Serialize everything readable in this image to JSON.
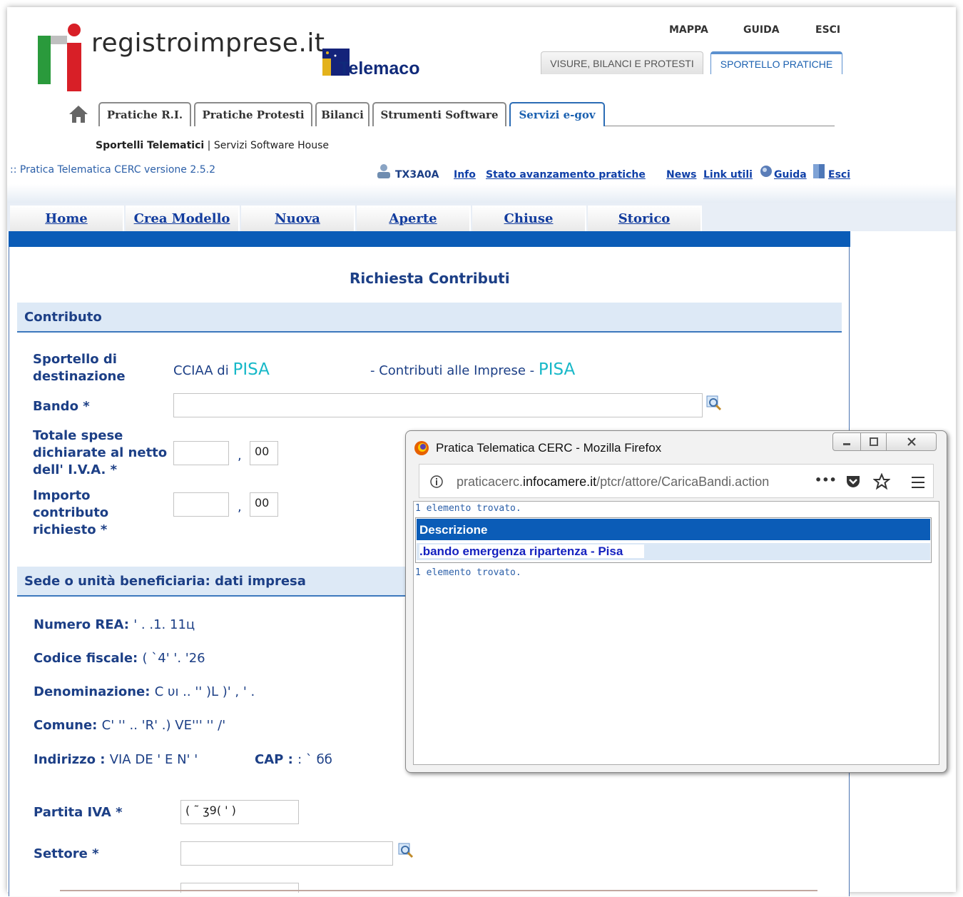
{
  "header": {
    "logo_text": "registroimprese.it",
    "telemaco_text": "Telemaco",
    "top_links": [
      "MAPPA",
      "GUIDA",
      "ESCI"
    ],
    "top_tabs": [
      "VISURE, BILANCI E PROTESTI",
      "SPORTELLO PRATICHE"
    ],
    "nav_tabs": [
      "Pratiche R.I.",
      "Pratiche Protesti",
      "Bilanci",
      "Strumenti Software",
      "Servizi e-gov"
    ],
    "sub_nav_bold": "Sportelli Telematici",
    "sub_nav_sep": "|",
    "sub_nav_other": "Servizi Software House",
    "version_line": ":: Pratica Telematica CERC versione 2.5.2",
    "user_code": "TX3A0A",
    "user_links": [
      "Info",
      "Stato avanzamento pratiche",
      "News",
      "Link utili",
      "Guida",
      "Esci"
    ]
  },
  "menu": {
    "tabs": [
      "Home",
      "Crea Modello",
      "Nuova",
      "Aperte",
      "Chiuse",
      "Storico"
    ]
  },
  "form": {
    "title": "Richiesta Contributi",
    "section_contributo": "Contributo",
    "sportello_label": "Sportello di destinazione",
    "cciaa_prefix": "CCIAA di",
    "cciaa_city": "PISA",
    "contributi_text": "- Contributi alle Imprese -",
    "contributi_city": "PISA",
    "bando_label": "Bando *",
    "bando_value": "",
    "totale_label": "Totale spese dichiarate al netto dell' I.V.A. *",
    "totale_int": "",
    "totale_dec": "00",
    "comma": ",",
    "importo_label": "Importo contributo richiesto *",
    "importo_int": "",
    "importo_dec": "00",
    "section_sede": "Sede o unità beneficiaria: dati impresa",
    "rea_label": "Numero REA:",
    "rea_value": "'  .  .1. 11ц",
    "cf_label": "Codice fiscale:",
    "cf_value": "( `4'   '. '26",
    "denominazione_label": "Denominazione:",
    "denominazione_value": "C   υı   .. '' )L )' ,  ' .",
    "comune_label": "Comune:",
    "comune_value": "C' '' .. 'R'   .) VE'''  '' /'",
    "indirizzo_label": "Indirizzo :",
    "indirizzo_value": "VIA DE   ' E N'   '",
    "cap_label": "CAP :",
    "cap_value": ": ` бб",
    "piva_label": "Partita IVA *",
    "piva_value": "( ˜ ʒ9( ' )",
    "settore_label": "Settore *",
    "settore_value": ""
  },
  "popup": {
    "title": "Pratica Telematica CERC - Mozilla Firefox",
    "url_prefix": "praticacerc.",
    "url_domain": "infocamere.it",
    "url_path": "/ptcr/attore/CaricaBandi.action",
    "url_more": "•••",
    "found_top": "1 elemento trovato.",
    "column_header": "Descrizione",
    "row_value": ".bando emergenza ripartenza - Pisa",
    "found_bottom": "1 elemento trovato."
  },
  "colors": {
    "accent_blue": "#0b5cb7",
    "label_blue": "#1c3f86",
    "city_cyan": "#17b8c8"
  }
}
